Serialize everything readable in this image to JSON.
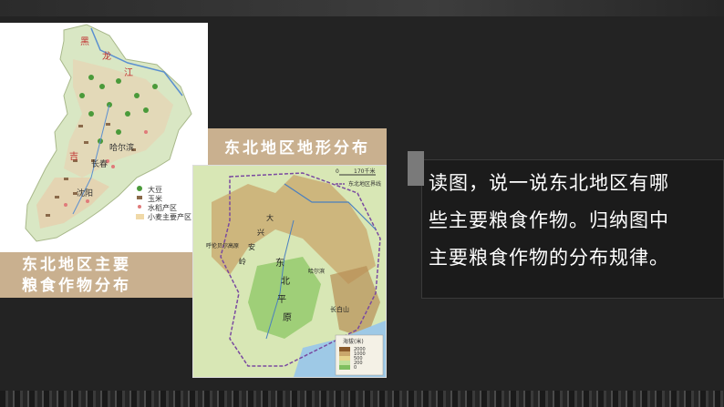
{
  "crop_map": {
    "labels": {
      "heilong_1": "黑",
      "heilong_2": "龙",
      "heilong_3": "江",
      "ji": "吉",
      "harbin": "哈尔滨",
      "changchun": "长春",
      "shenyang": "沈阳"
    },
    "legend": [
      {
        "label": "大豆",
        "color": "#4a9a3a"
      },
      {
        "label": "玉米",
        "color": "#8a6a4a"
      },
      {
        "label": "水稻产区",
        "color": "#e07a7a"
      },
      {
        "label": "小麦主要产区",
        "color": "#f0d9a8"
      }
    ],
    "caption_line1": "东北地区主要",
    "caption_line2": "粮食作物分布"
  },
  "terrain_map": {
    "title": "东北地区地形分布",
    "scale_text": "170千米",
    "scale_zero": "0",
    "boundary_label": "东北地区界线",
    "labels": {
      "da": "大",
      "xing": "兴",
      "an": "安",
      "ling": "岭",
      "dong": "东",
      "bei": "北",
      "ping": "平",
      "yuan": "原",
      "hulunbeier": "呼伦贝尔高原",
      "harbin": "哈尔滨",
      "changbai": "长白山"
    },
    "legend_title": "海拔(米)",
    "legend_levels": [
      "2000",
      "1000",
      "500",
      "200",
      "0"
    ]
  },
  "question": {
    "line1": "读图，说一说东北地区有哪",
    "line2": "些主要粮食作物。归纳图中",
    "line3": "主要粮食作物的分布规律。"
  },
  "colors": {
    "background": "#232323",
    "caption_bg": "#c9b08f",
    "question_bg": "#1b1b1b"
  }
}
